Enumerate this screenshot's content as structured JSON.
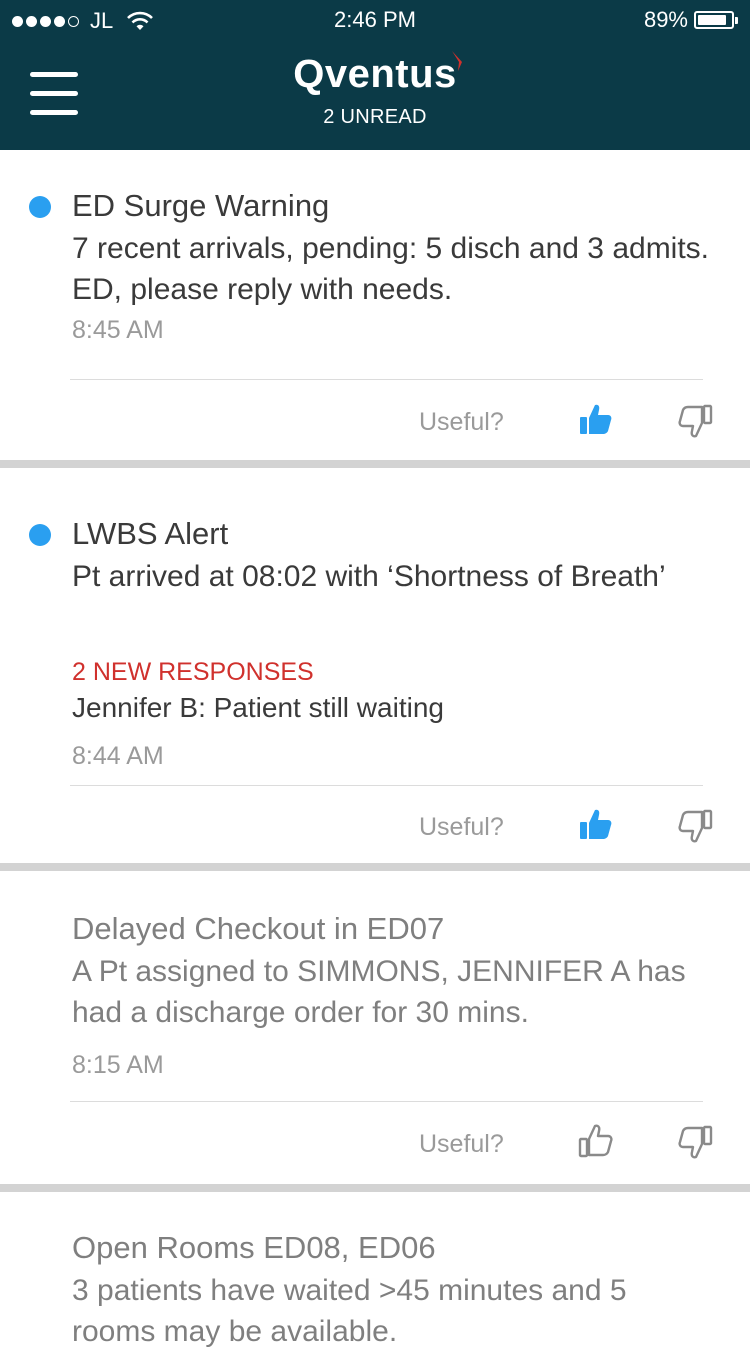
{
  "status_bar": {
    "carrier": "JL",
    "time": "2:46 PM",
    "battery": "89%",
    "battery_level": 0.89
  },
  "header": {
    "logo": "Qventus",
    "unread": "2 UNREAD"
  },
  "colors": {
    "header_bg": "#0b3a47",
    "unread_dot": "#2a9ff0",
    "accent_red": "#d0312d",
    "thumb_active": "#2a9ff0"
  },
  "feedback_label": "Useful?",
  "notifications": [
    {
      "title": "ED Surge Warning",
      "body": "7 recent arrivals, pending: 5 disch and 3 admits. ED, please reply with needs.",
      "time": "8:45 AM",
      "unread": true,
      "liked": true
    },
    {
      "title": "LWBS Alert",
      "body": "Pt arrived at 08:02 with ‘Shortness of Breath’",
      "responses": "2 NEW RESPONSES",
      "reply": "Jennifer B: Patient still waiting",
      "time": "8:44 AM",
      "unread": true,
      "liked": true
    },
    {
      "title": "Delayed Checkout in ED07",
      "body": "A Pt assigned to SIMMONS, JENNIFER A has had a discharge order for 30 mins.",
      "time": "8:15 AM",
      "unread": false,
      "liked": false
    },
    {
      "title": "Open Rooms ED08, ED06",
      "body": "3 patients have waited >45 minutes and 5 rooms may be available.",
      "unread": false
    }
  ]
}
